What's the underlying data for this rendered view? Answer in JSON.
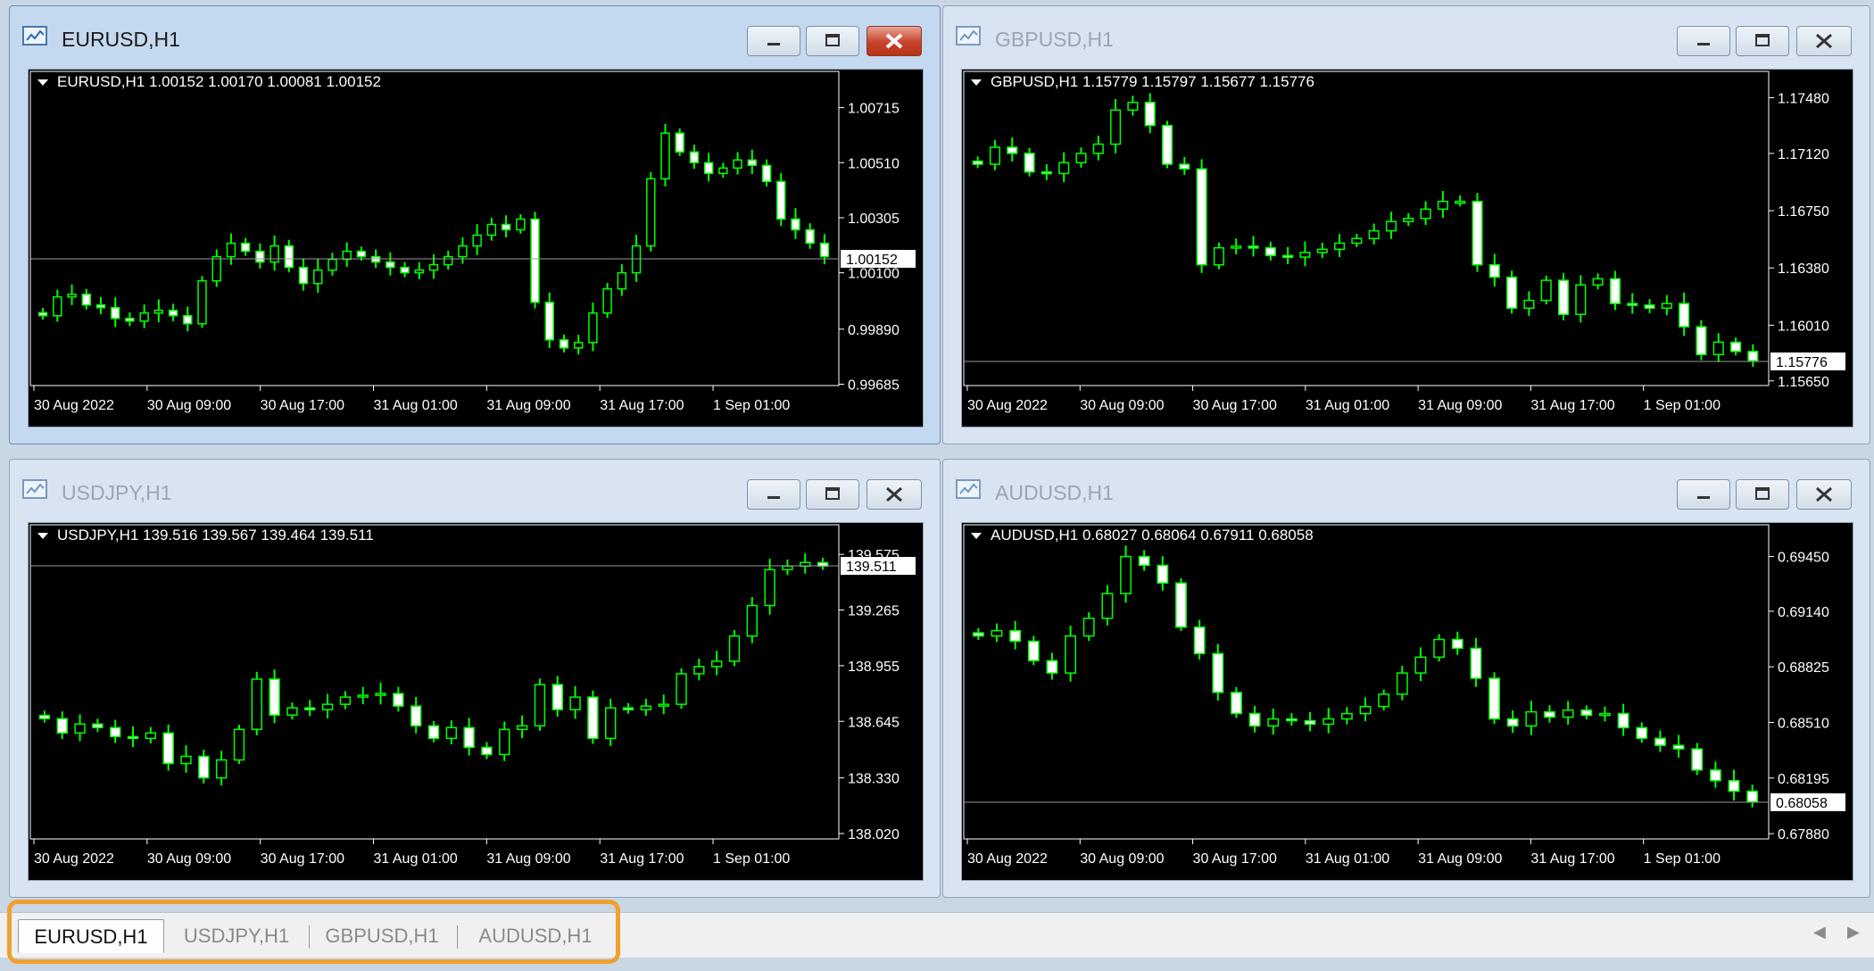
{
  "windows": [
    {
      "id": "eurusd",
      "title": "EURUSD,H1",
      "active": true,
      "header": "EURUSD,H1  1.00152 1.00170 1.00081 1.00152",
      "price_labels": [
        "1.00715",
        "1.00510",
        "1.00305",
        "1.00100",
        "0.99890",
        "0.99685"
      ],
      "price_range": [
        0.9968,
        1.0085
      ],
      "current_price": "1.00152",
      "time_labels": [
        "30 Aug 2022",
        "30 Aug 09:00",
        "30 Aug 17:00",
        "31 Aug 01:00",
        "31 Aug 09:00",
        "31 Aug 17:00",
        "1 Sep 01:00"
      ]
    },
    {
      "id": "gbpusd",
      "title": "GBPUSD,H1",
      "active": false,
      "header": "GBPUSD,H1  1.15779 1.15797 1.15677 1.15776",
      "price_labels": [
        "1.17480",
        "1.17120",
        "1.16750",
        "1.16380",
        "1.16010",
        "1.15650"
      ],
      "price_range": [
        1.1562,
        1.1765
      ],
      "current_price": "1.15776",
      "time_labels": [
        "30 Aug 2022",
        "30 Aug 09:00",
        "30 Aug 17:00",
        "31 Aug 01:00",
        "31 Aug 09:00",
        "31 Aug 17:00",
        "1 Sep 01:00"
      ]
    },
    {
      "id": "usdjpy",
      "title": "USDJPY,H1",
      "active": false,
      "header": "USDJPY,H1  139.516 139.567 139.464 139.511",
      "price_labels": [
        "139.575",
        "139.265",
        "138.955",
        "138.645",
        "138.330",
        "138.020"
      ],
      "price_range": [
        137.99,
        139.74
      ],
      "current_price": "139.511",
      "time_labels": [
        "30 Aug 2022",
        "30 Aug 09:00",
        "30 Aug 17:00",
        "31 Aug 01:00",
        "31 Aug 09:00",
        "31 Aug 17:00",
        "1 Sep 01:00"
      ]
    },
    {
      "id": "audusd",
      "title": "AUDUSD,H1",
      "active": false,
      "header": "AUDUSD,H1  0.68027 0.68064 0.67911 0.68058",
      "price_labels": [
        "0.69450",
        "0.69140",
        "0.68825",
        "0.68510",
        "0.68195",
        "0.67880"
      ],
      "price_range": [
        0.6785,
        0.6963
      ],
      "current_price": "0.68058",
      "time_labels": [
        "30 Aug 2022",
        "30 Aug 09:00",
        "30 Aug 17:00",
        "31 Aug 01:00",
        "31 Aug 09:00",
        "31 Aug 17:00",
        "1 Sep 01:00"
      ]
    }
  ],
  "chart_data": [
    {
      "type": "candlestick",
      "title": "EURUSD,H1",
      "x": "H1",
      "close": [
        0.9994,
        1.0001,
        1.0002,
        0.9998,
        0.9997,
        0.9993,
        0.9992,
        0.9995,
        0.9996,
        0.9994,
        0.9991,
        1.0007,
        1.0016,
        1.0021,
        1.0018,
        1.0014,
        1.002,
        1.0012,
        1.0006,
        1.0011,
        1.0015,
        1.0018,
        1.0016,
        1.0014,
        1.0012,
        1.001,
        1.0011,
        1.0013,
        1.0016,
        1.002,
        1.0024,
        1.0028,
        1.0026,
        1.003,
        0.9999,
        0.9985,
        0.9982,
        0.9984,
        0.9995,
        1.0004,
        1.001,
        1.002,
        1.0045,
        1.0062,
        1.0055,
        1.0051,
        1.0047,
        1.0049,
        1.0052,
        1.005,
        1.0044,
        1.003,
        1.0026,
        1.0021,
        1.0016
      ]
    },
    {
      "type": "candlestick",
      "title": "GBPUSD,H1",
      "x": "H1",
      "close": [
        1.1705,
        1.1716,
        1.1712,
        1.17,
        1.1699,
        1.1706,
        1.1712,
        1.1718,
        1.174,
        1.1745,
        1.173,
        1.1705,
        1.1702,
        1.164,
        1.1651,
        1.1652,
        1.1651,
        1.1646,
        1.1645,
        1.1648,
        1.165,
        1.1654,
        1.1657,
        1.1662,
        1.1668,
        1.167,
        1.1676,
        1.1681,
        1.1681,
        1.164,
        1.1632,
        1.1612,
        1.1617,
        1.163,
        1.1608,
        1.1627,
        1.1631,
        1.1615,
        1.1614,
        1.1612,
        1.1615,
        1.16,
        1.1582,
        1.159,
        1.1584,
        1.1578
      ]
    },
    {
      "type": "candlestick",
      "title": "USDJPY,H1",
      "x": "H1",
      "close": [
        138.66,
        138.58,
        138.63,
        138.61,
        138.56,
        138.55,
        138.58,
        138.41,
        138.45,
        138.33,
        138.43,
        138.6,
        138.88,
        138.68,
        138.72,
        138.71,
        138.74,
        138.78,
        138.79,
        138.8,
        138.73,
        138.62,
        138.55,
        138.61,
        138.5,
        138.46,
        138.6,
        138.62,
        138.85,
        138.71,
        138.78,
        138.55,
        138.72,
        138.71,
        138.73,
        138.74,
        138.91,
        138.95,
        138.98,
        139.12,
        139.29,
        139.49,
        139.51,
        139.53,
        139.51
      ]
    },
    {
      "type": "candlestick",
      "title": "AUDUSD,H1",
      "x": "H1",
      "close": [
        0.69,
        0.6903,
        0.6897,
        0.6886,
        0.6879,
        0.69,
        0.691,
        0.6924,
        0.6945,
        0.694,
        0.693,
        0.6905,
        0.689,
        0.6868,
        0.6856,
        0.6849,
        0.6853,
        0.6852,
        0.685,
        0.6853,
        0.6856,
        0.686,
        0.6867,
        0.6879,
        0.6888,
        0.6898,
        0.6893,
        0.6876,
        0.6853,
        0.6849,
        0.6857,
        0.6854,
        0.6858,
        0.6855,
        0.6856,
        0.6848,
        0.6842,
        0.6838,
        0.6836,
        0.6824,
        0.6818,
        0.6812,
        0.6806
      ]
    }
  ],
  "tabs": [
    {
      "label": "EURUSD,H1",
      "active": true
    },
    {
      "label": "USDJPY,H1",
      "active": false
    },
    {
      "label": "GBPUSD,H1",
      "active": false
    },
    {
      "label": "AUDUSD,H1",
      "active": false
    }
  ],
  "scroll": {
    "left": "◀",
    "right": "▶"
  },
  "colors": {
    "candle_up": "#00ff00",
    "candle_down_body": "#ffffff",
    "chart_bg": "#000000",
    "highlight": "#f0a030"
  }
}
